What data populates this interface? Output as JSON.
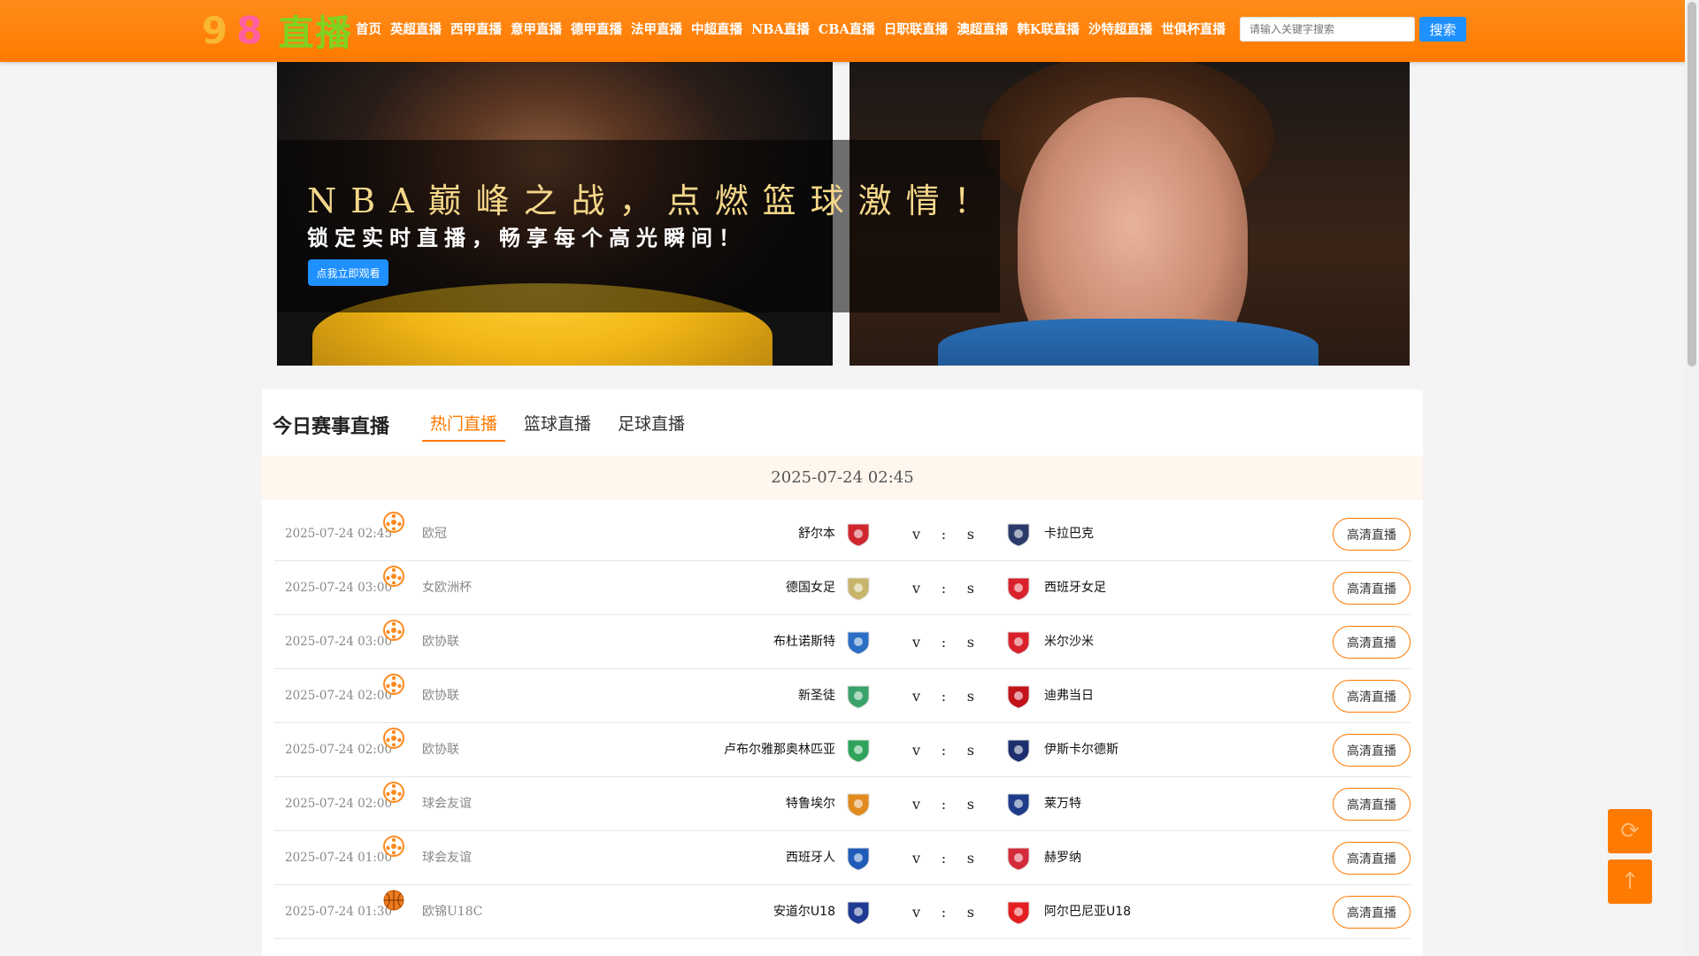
{
  "logo": {
    "digits_1": "9",
    "digits_2": "8",
    "text": "直播"
  },
  "nav": [
    "首页",
    "英超直播",
    "西甲直播",
    "意甲直播",
    "德甲直播",
    "法甲直播",
    "中超直播",
    "NBA直播",
    "CBA直播",
    "日职联直播",
    "澳超直播",
    "韩K联直播",
    "沙特超直播",
    "世俱杯直播"
  ],
  "search": {
    "placeholder": "请输入关键字搜索",
    "button": "搜索"
  },
  "banner": {
    "headline": "NBA巅峰之战，点燃篮球激情！",
    "subline": "锁定实时直播，畅享每个高光瞬间！",
    "cta": "点我立即观看"
  },
  "panel": {
    "title": "今日赛事直播",
    "tabs": [
      "热门直播",
      "篮球直播",
      "足球直播"
    ],
    "date": "2025-07-24 02:45"
  },
  "matches": [
    {
      "time": "2025-07-24 02:45",
      "sport": "football",
      "league": "欧冠",
      "home": "舒尔本",
      "home_color": "#d0272f",
      "away": "卡拉巴克",
      "away_color": "#2a3a6b",
      "score": [
        "v",
        ":",
        "s"
      ],
      "button": "高清直播"
    },
    {
      "time": "2025-07-24 03:00",
      "sport": "football",
      "league": "女欧洲杯",
      "home": "德国女足",
      "home_color": "#c8b46a",
      "away": "西班牙女足",
      "away_color": "#d9212c",
      "score": [
        "v",
        ":",
        "s"
      ],
      "button": "高清直播"
    },
    {
      "time": "2025-07-24 03:00",
      "sport": "football",
      "league": "欧协联",
      "home": "布杜诺斯特",
      "home_color": "#2a6fc4",
      "away": "米尔沙米",
      "away_color": "#d9212c",
      "score": [
        "v",
        ":",
        "s"
      ],
      "button": "高清直播"
    },
    {
      "time": "2025-07-24 02:00",
      "sport": "football",
      "league": "欧协联",
      "home": "新圣徒",
      "home_color": "#3aa36b",
      "away": "迪弗当日",
      "away_color": "#c2121a",
      "score": [
        "v",
        ":",
        "s"
      ],
      "button": "高清直播"
    },
    {
      "time": "2025-07-24 02:00",
      "sport": "football",
      "league": "欧协联",
      "home": "卢布尔雅那奥林匹亚",
      "home_color": "#2ea35a",
      "away": "伊斯卡尔德斯",
      "away_color": "#1d2e6e",
      "score": [
        "v",
        ":",
        "s"
      ],
      "button": "高清直播"
    },
    {
      "time": "2025-07-24 02:00",
      "sport": "football",
      "league": "球会友谊",
      "home": "特鲁埃尔",
      "home_color": "#e18a1d",
      "away": "莱万特",
      "away_color": "#1e3c8a",
      "score": [
        "v",
        ":",
        "s"
      ],
      "button": "高清直播"
    },
    {
      "time": "2025-07-24 01:00",
      "sport": "football",
      "league": "球会友谊",
      "home": "西班牙人",
      "home_color": "#1f5bb8",
      "away": "赫罗纳",
      "away_color": "#d32a3a",
      "score": [
        "v",
        ":",
        "s"
      ],
      "button": "高清直播"
    },
    {
      "time": "2025-07-24 01:30",
      "sport": "basketball",
      "league": "欧锦U18C",
      "home": "安道尔U18",
      "home_color": "#1f3a93",
      "away": "阿尔巴尼亚U18",
      "away_color": "#e41e20",
      "score": [
        "v",
        ":",
        "s"
      ],
      "button": "高清直播"
    }
  ],
  "float": {
    "top_icon": "refresh-icon",
    "bottom_icon": "arrow-up-icon"
  }
}
